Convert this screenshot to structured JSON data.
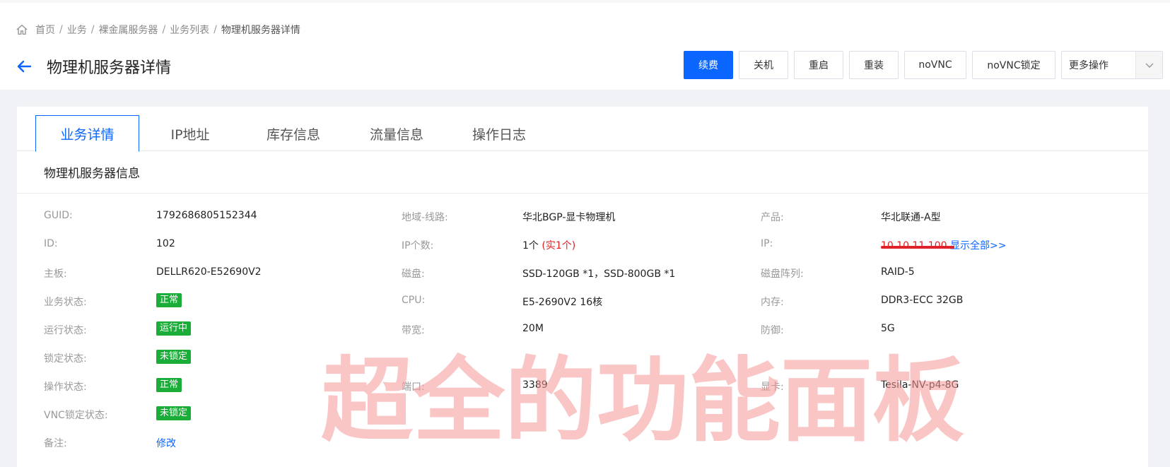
{
  "breadcrumb": {
    "items": [
      "首页",
      "业务",
      "裸金属服务器",
      "业务列表"
    ],
    "current": "物理机服务器详情"
  },
  "header": {
    "title": "物理机服务器详情"
  },
  "actions": {
    "renew": "续费",
    "shutdown": "关机",
    "restart": "重启",
    "reinstall": "重装",
    "novnc": "noVNC",
    "novnc_lock": "noVNC锁定",
    "more": "更多操作"
  },
  "tabs": [
    "业务详情",
    "IP地址",
    "库存信息",
    "流量信息",
    "操作日志"
  ],
  "section": {
    "title": "物理机服务器信息"
  },
  "info": {
    "col1": [
      {
        "label": "GUID:",
        "value": "1792686805152344"
      },
      {
        "label": "ID:",
        "value": "102"
      },
      {
        "label": "主板:",
        "value": "DELLR620-E52690V2"
      },
      {
        "label": "业务状态:",
        "tag": "正常"
      },
      {
        "label": "运行状态:",
        "tag": "运行中"
      },
      {
        "label": "锁定状态:",
        "tag": "未锁定"
      },
      {
        "label": "操作状态:",
        "tag": "正常"
      },
      {
        "label": "VNC锁定状态:",
        "tag": "未锁定"
      },
      {
        "label": "备注:",
        "link": "修改"
      }
    ],
    "col2": [
      {
        "label": "地域-线路:",
        "value": "华北BGP-显卡物理机"
      },
      {
        "label": "IP个数:",
        "value": "1个",
        "extra": "(实1个)"
      },
      {
        "label": "磁盘:",
        "value": "SSD-120GB *1，SSD-800GB *1"
      },
      {
        "label": "CPU:",
        "value": "E5-2690V2 16核"
      },
      {
        "label": "带宽:",
        "value": "20M"
      },
      {
        "label": "端口:",
        "value": "3389"
      }
    ],
    "col3": [
      {
        "label": "产品:",
        "value": "华北联通-A型"
      },
      {
        "label": "IP:",
        "value": "10.10.11.100",
        "link": "显示全部>>"
      },
      {
        "label": "磁盘阵列:",
        "value": "RAID-5"
      },
      {
        "label": "内存:",
        "value": "DDR3-ECC 32GB"
      },
      {
        "label": "防御:",
        "value": "5G"
      },
      {
        "label": "显卡:",
        "value": "Tesila-NV-p4-8G"
      }
    ]
  },
  "watermark": "超全的功能面板",
  "colors": {
    "primary": "#0a66ff",
    "tag_green": "#1aad38",
    "red": "#e02020"
  }
}
